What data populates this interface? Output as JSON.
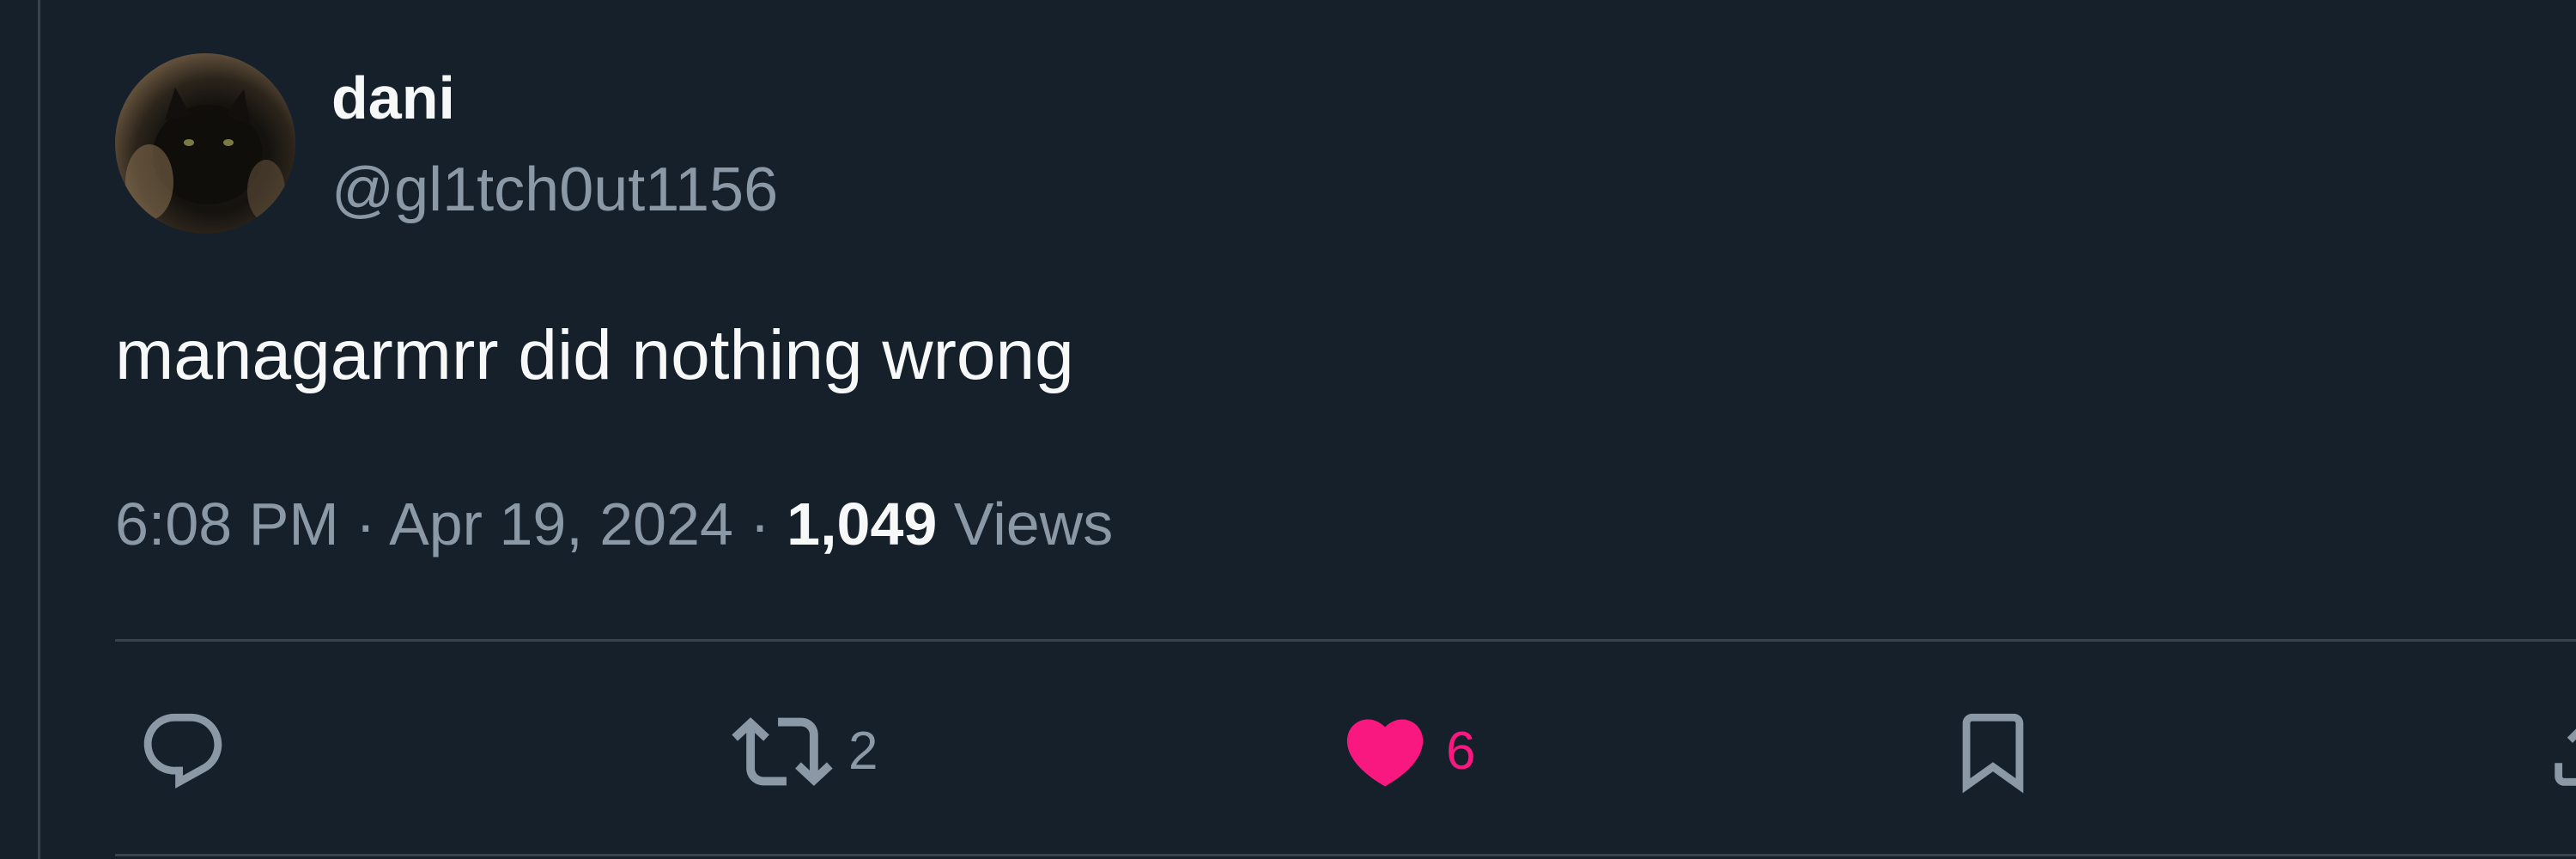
{
  "tweet": {
    "display_name": "dani",
    "handle": "@gl1tch0ut1156",
    "text": "managarmrr did nothing wrong",
    "time": "6:08 PM",
    "separator": "·",
    "date": "Apr 19, 2024",
    "views_count": "1,049",
    "views_label": "Views"
  },
  "actions": {
    "reply_count": "",
    "retweet_count": "2",
    "like_count": "6",
    "like_active": true
  },
  "colors": {
    "background": "#15202b",
    "text_primary": "#f7f9f9",
    "text_secondary": "#8b98a5",
    "like_active": "#f91880",
    "border": "#38444d"
  },
  "icons": {
    "reply": "speech-bubble-icon",
    "retweet": "retweet-arrows-icon",
    "like": "heart-icon",
    "bookmark": "bookmark-icon",
    "share": "share-icon"
  }
}
